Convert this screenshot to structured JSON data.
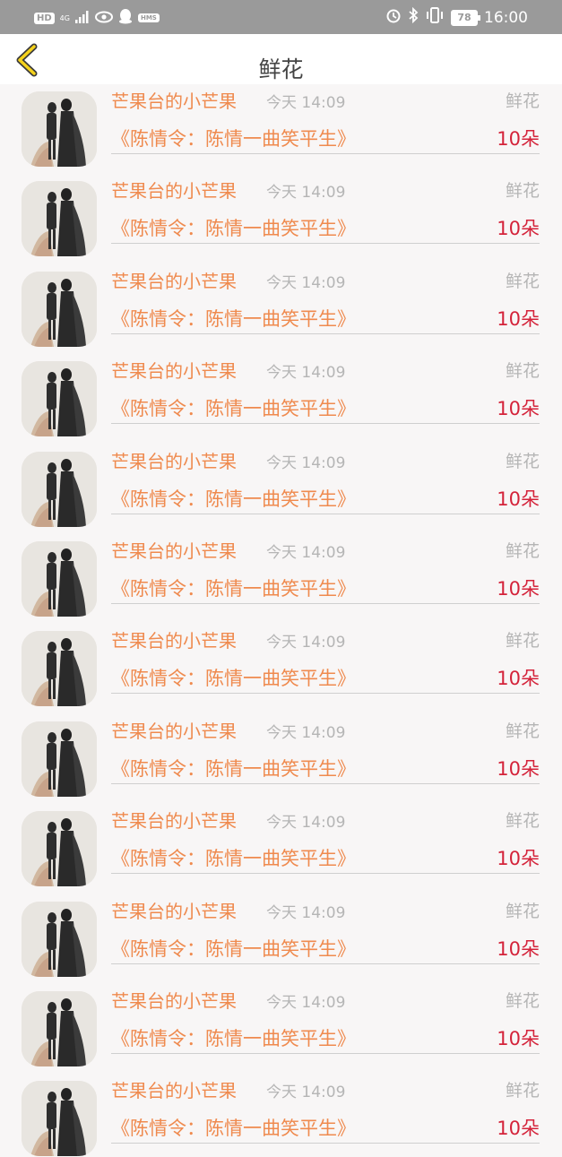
{
  "status_bar": {
    "left_badges": [
      "HD",
      "4G",
      "HMS"
    ],
    "time": "16:00",
    "battery": "78"
  },
  "header": {
    "title": "鲜花"
  },
  "colors": {
    "name": "#ef8a4e",
    "count": "#d4233a",
    "muted": "#b5b5b5"
  },
  "gifts": [
    {
      "name": "芒果台的小芒果",
      "time": "今天 14:09",
      "gift": "鲜花",
      "message": "《陈情令：陈情一曲笑平生》",
      "count": "10朵"
    },
    {
      "name": "芒果台的小芒果",
      "time": "今天 14:09",
      "gift": "鲜花",
      "message": "《陈情令：陈情一曲笑平生》",
      "count": "10朵"
    },
    {
      "name": "芒果台的小芒果",
      "time": "今天 14:09",
      "gift": "鲜花",
      "message": "《陈情令：陈情一曲笑平生》",
      "count": "10朵"
    },
    {
      "name": "芒果台的小芒果",
      "time": "今天 14:09",
      "gift": "鲜花",
      "message": "《陈情令：陈情一曲笑平生》",
      "count": "10朵"
    },
    {
      "name": "芒果台的小芒果",
      "time": "今天 14:09",
      "gift": "鲜花",
      "message": "《陈情令：陈情一曲笑平生》",
      "count": "10朵"
    },
    {
      "name": "芒果台的小芒果",
      "time": "今天 14:09",
      "gift": "鲜花",
      "message": "《陈情令：陈情一曲笑平生》",
      "count": "10朵"
    },
    {
      "name": "芒果台的小芒果",
      "time": "今天 14:09",
      "gift": "鲜花",
      "message": "《陈情令：陈情一曲笑平生》",
      "count": "10朵"
    },
    {
      "name": "芒果台的小芒果",
      "time": "今天 14:09",
      "gift": "鲜花",
      "message": "《陈情令：陈情一曲笑平生》",
      "count": "10朵"
    },
    {
      "name": "芒果台的小芒果",
      "time": "今天 14:09",
      "gift": "鲜花",
      "message": "《陈情令：陈情一曲笑平生》",
      "count": "10朵"
    },
    {
      "name": "芒果台的小芒果",
      "time": "今天 14:09",
      "gift": "鲜花",
      "message": "《陈情令：陈情一曲笑平生》",
      "count": "10朵"
    },
    {
      "name": "芒果台的小芒果",
      "time": "今天 14:09",
      "gift": "鲜花",
      "message": "《陈情令：陈情一曲笑平生》",
      "count": "10朵"
    },
    {
      "name": "芒果台的小芒果",
      "time": "今天 14:09",
      "gift": "鲜花",
      "message": "《陈情令：陈情一曲笑平生》",
      "count": "10朵"
    }
  ]
}
